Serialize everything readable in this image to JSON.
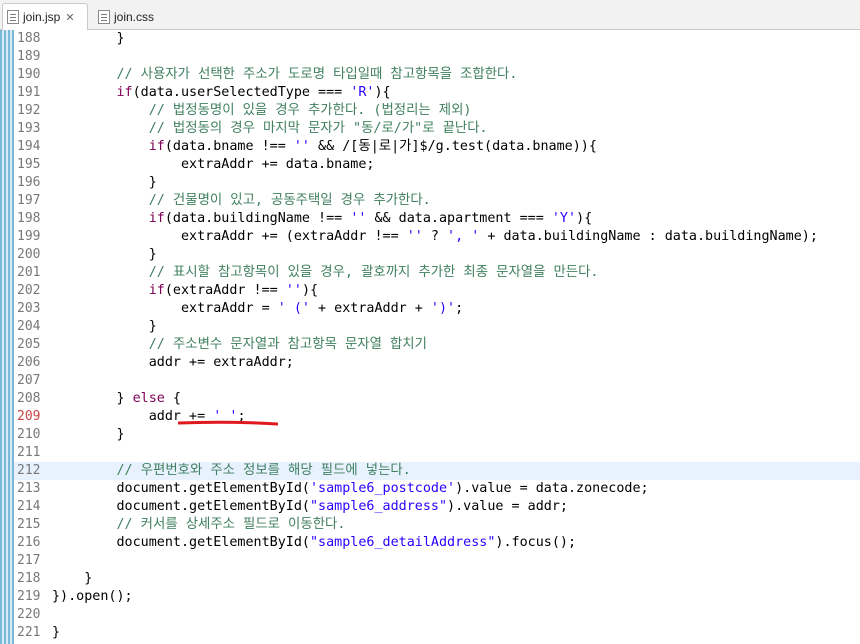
{
  "tabs": [
    {
      "label": "join.jsp",
      "active": true,
      "icon": "jsp-file-icon"
    },
    {
      "label": "join.css",
      "active": false,
      "icon": "css-file-icon"
    }
  ],
  "close_glyph": "✕",
  "editor": {
    "highlighted_line": "209",
    "current_line": "212",
    "lines": [
      {
        "n": "188",
        "tokens": [
          {
            "t": "        }",
            "c": "n"
          }
        ]
      },
      {
        "n": "189",
        "tokens": []
      },
      {
        "n": "190",
        "tokens": [
          {
            "t": "        // 사용자가 선택한 주소가 도로명 타입일때 참고항목을 조합한다.",
            "c": "cm"
          }
        ]
      },
      {
        "n": "191",
        "tokens": [
          {
            "t": "        ",
            "c": "n"
          },
          {
            "t": "if",
            "c": "kw"
          },
          {
            "t": "(data.userSelectedType === ",
            "c": "n"
          },
          {
            "t": "'R'",
            "c": "str"
          },
          {
            "t": "){",
            "c": "n"
          }
        ]
      },
      {
        "n": "192",
        "tokens": [
          {
            "t": "            // 법정동명이 있을 경우 추가한다. (법정리는 제외)",
            "c": "cm"
          }
        ]
      },
      {
        "n": "193",
        "tokens": [
          {
            "t": "            // 법정동의 경우 마지막 문자가 \"동/로/가\"로 끝난다.",
            "c": "cm"
          }
        ]
      },
      {
        "n": "194",
        "tokens": [
          {
            "t": "            ",
            "c": "n"
          },
          {
            "t": "if",
            "c": "kw"
          },
          {
            "t": "(data.bname !== ",
            "c": "n"
          },
          {
            "t": "''",
            "c": "str"
          },
          {
            "t": " && /[동|로|가]$/g.test(data.bname)){",
            "c": "n"
          }
        ]
      },
      {
        "n": "195",
        "tokens": [
          {
            "t": "                extraAddr += data.bname;",
            "c": "n"
          }
        ]
      },
      {
        "n": "196",
        "tokens": [
          {
            "t": "            }",
            "c": "n"
          }
        ]
      },
      {
        "n": "197",
        "tokens": [
          {
            "t": "            // 건물명이 있고, 공동주택일 경우 추가한다.",
            "c": "cm"
          }
        ]
      },
      {
        "n": "198",
        "tokens": [
          {
            "t": "            ",
            "c": "n"
          },
          {
            "t": "if",
            "c": "kw"
          },
          {
            "t": "(data.buildingName !== ",
            "c": "n"
          },
          {
            "t": "''",
            "c": "str"
          },
          {
            "t": " && data.apartment === ",
            "c": "n"
          },
          {
            "t": "'Y'",
            "c": "str"
          },
          {
            "t": "){",
            "c": "n"
          }
        ]
      },
      {
        "n": "199",
        "tokens": [
          {
            "t": "                extraAddr += (extraAddr !== ",
            "c": "n"
          },
          {
            "t": "''",
            "c": "str"
          },
          {
            "t": " ? ",
            "c": "n"
          },
          {
            "t": "', '",
            "c": "str"
          },
          {
            "t": " + data.buildingName : data.buildingName);",
            "c": "n"
          }
        ]
      },
      {
        "n": "200",
        "tokens": [
          {
            "t": "            }",
            "c": "n"
          }
        ]
      },
      {
        "n": "201",
        "tokens": [
          {
            "t": "            // 표시할 참고항목이 있을 경우, 괄호까지 추가한 최종 문자열을 만든다.",
            "c": "cm"
          }
        ]
      },
      {
        "n": "202",
        "tokens": [
          {
            "t": "            ",
            "c": "n"
          },
          {
            "t": "if",
            "c": "kw"
          },
          {
            "t": "(extraAddr !== ",
            "c": "n"
          },
          {
            "t": "''",
            "c": "str"
          },
          {
            "t": "){",
            "c": "n"
          }
        ]
      },
      {
        "n": "203",
        "tokens": [
          {
            "t": "                extraAddr = ",
            "c": "n"
          },
          {
            "t": "' ('",
            "c": "str"
          },
          {
            "t": " + extraAddr + ",
            "c": "n"
          },
          {
            "t": "')'",
            "c": "str"
          },
          {
            "t": ";",
            "c": "n"
          }
        ]
      },
      {
        "n": "204",
        "tokens": [
          {
            "t": "            }",
            "c": "n"
          }
        ]
      },
      {
        "n": "205",
        "tokens": [
          {
            "t": "            // 주소변수 문자열과 참고항목 문자열 합치기",
            "c": "cm"
          }
        ]
      },
      {
        "n": "206",
        "tokens": [
          {
            "t": "            addr += extraAddr;",
            "c": "n"
          }
        ]
      },
      {
        "n": "207",
        "tokens": []
      },
      {
        "n": "208",
        "tokens": [
          {
            "t": "        } ",
            "c": "n"
          },
          {
            "t": "else",
            "c": "kw"
          },
          {
            "t": " {",
            "c": "n"
          }
        ]
      },
      {
        "n": "209",
        "tokens": [
          {
            "t": "            addr += ",
            "c": "n"
          },
          {
            "t": "' '",
            "c": "str"
          },
          {
            "t": ";",
            "c": "n"
          }
        ]
      },
      {
        "n": "210",
        "tokens": [
          {
            "t": "        }",
            "c": "n"
          }
        ]
      },
      {
        "n": "211",
        "tokens": []
      },
      {
        "n": "212",
        "tokens": [
          {
            "t": "        // 우편번호와 주소 정보를 해당 필드에 넣는다.",
            "c": "cm"
          }
        ]
      },
      {
        "n": "213",
        "tokens": [
          {
            "t": "        document.getElementById(",
            "c": "n"
          },
          {
            "t": "'sample6_postcode'",
            "c": "str"
          },
          {
            "t": ").value = data.zonecode;",
            "c": "n"
          }
        ]
      },
      {
        "n": "214",
        "tokens": [
          {
            "t": "        document.getElementById(",
            "c": "n"
          },
          {
            "t": "\"sample6_address\"",
            "c": "str"
          },
          {
            "t": ").value = addr;",
            "c": "n"
          }
        ]
      },
      {
        "n": "215",
        "tokens": [
          {
            "t": "        // 커서를 상세주소 필드로 이동한다.",
            "c": "cm"
          }
        ]
      },
      {
        "n": "216",
        "tokens": [
          {
            "t": "        document.getElementById(",
            "c": "n"
          },
          {
            "t": "\"sample6_detailAddress\"",
            "c": "str"
          },
          {
            "t": ").focus();",
            "c": "n"
          }
        ]
      },
      {
        "n": "217",
        "tokens": []
      },
      {
        "n": "218",
        "tokens": [
          {
            "t": "    }",
            "c": "n"
          }
        ]
      },
      {
        "n": "219",
        "tokens": [
          {
            "t": "}).open();",
            "c": "n"
          }
        ]
      },
      {
        "n": "220",
        "tokens": []
      },
      {
        "n": "221",
        "tokens": [
          {
            "t": "}",
            "c": "n"
          }
        ]
      }
    ]
  }
}
